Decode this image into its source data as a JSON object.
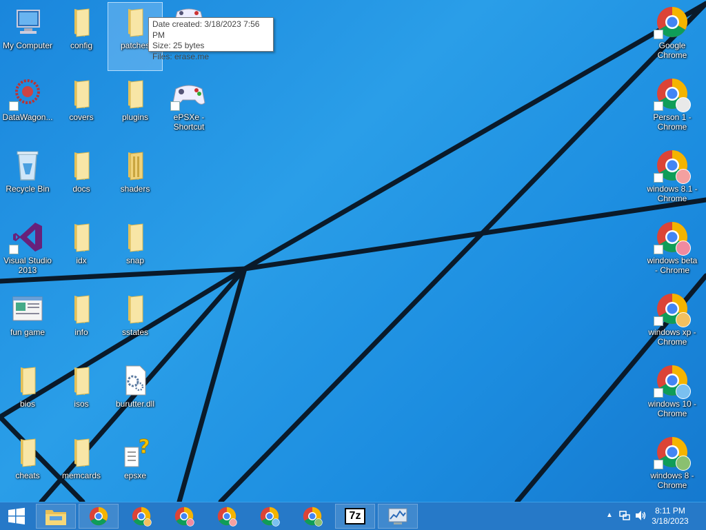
{
  "desktop": {
    "icons_left": [
      {
        "label": "My Computer"
      },
      {
        "label": "config"
      },
      {
        "label": "patches"
      },
      {
        "label": "DataWagon..."
      },
      {
        "label": "covers"
      },
      {
        "label": "plugins"
      },
      {
        "label": "ePSXe - Shortcut"
      },
      {
        "label": "Recycle Bin"
      },
      {
        "label": "docs"
      },
      {
        "label": "shaders"
      },
      {
        "label": "Visual Studio 2013"
      },
      {
        "label": "idx"
      },
      {
        "label": "snap"
      },
      {
        "label": "fun game"
      },
      {
        "label": "info"
      },
      {
        "label": "sstates"
      },
      {
        "label": "bios"
      },
      {
        "label": "isos"
      },
      {
        "label": "burutter.dll"
      },
      {
        "label": "cheats"
      },
      {
        "label": "memcards"
      },
      {
        "label": "epsxe"
      }
    ],
    "icons_right": [
      {
        "label": "Google Chrome"
      },
      {
        "label": "Person 1 - Chrome"
      },
      {
        "label": "windows 8.1 - Chrome"
      },
      {
        "label": "windows beta - Chrome"
      },
      {
        "label": "windows xp - Chrome"
      },
      {
        "label": "windows 10 - Chrome"
      },
      {
        "label": "windows 8 - Chrome"
      }
    ]
  },
  "tooltip": {
    "line1": "Date created: 3/18/2023 7:56 PM",
    "line2": "Size: 25 bytes",
    "line3": "Files: erase.me"
  },
  "taskbar": {
    "clock_time": "8:11 PM",
    "clock_date": "3/18/2023",
    "sevenzip_label": "7z"
  },
  "colors": {
    "accent": "#1a86dc",
    "taskbar": "#146ec3",
    "folder": "#f3d67a"
  }
}
